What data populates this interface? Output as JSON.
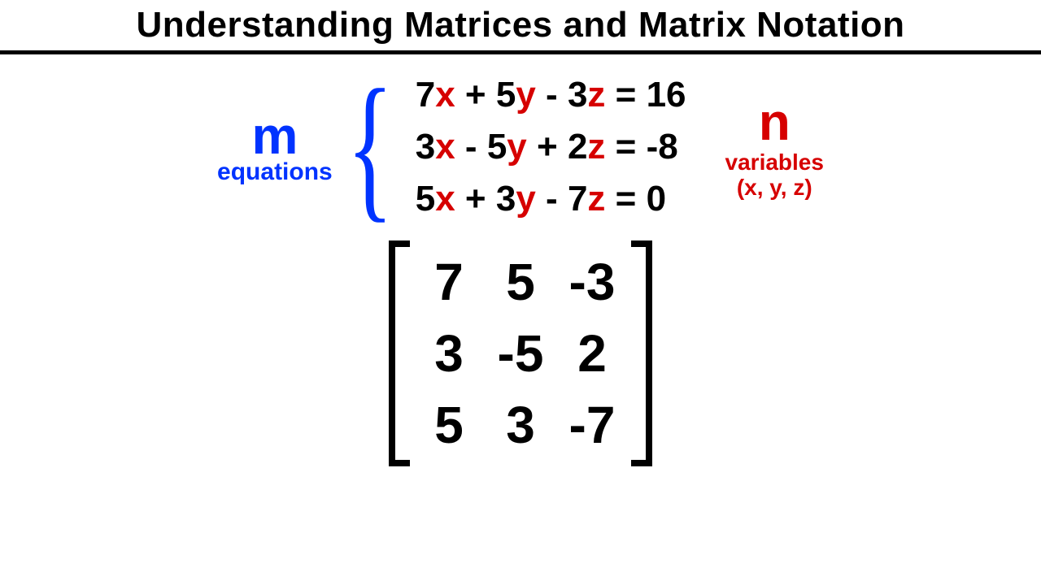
{
  "title": "Understanding Matrices and Matrix Notation",
  "m_label": {
    "big": "m",
    "sub": "equations"
  },
  "n_label": {
    "big": "n",
    "sub": "variables",
    "sub2": "(x, y, z)"
  },
  "equations": [
    {
      "c1": "7",
      "v1": "x",
      "s1": " + ",
      "c2": "5",
      "v2": "y",
      "s2": " - ",
      "c3": "3",
      "v3": "z",
      "eq": " = ",
      "rhs": "16"
    },
    {
      "c1": "3",
      "v1": "x",
      "s1": " - ",
      "c2": "5",
      "v2": "y",
      "s2": " + ",
      "c3": "2",
      "v3": "z",
      "eq": " = ",
      "rhs": "-8"
    },
    {
      "c1": "5",
      "v1": "x",
      "s1": " + ",
      "c2": "3",
      "v2": "y",
      "s2": " - ",
      "c3": "7",
      "v3": "z",
      "eq": " = ",
      "rhs": "0"
    }
  ],
  "matrix": [
    [
      "7",
      "5",
      "-3"
    ],
    [
      "3",
      "-5",
      "2"
    ],
    [
      "5",
      "3",
      "-7"
    ]
  ],
  "brace_glyph": "{"
}
